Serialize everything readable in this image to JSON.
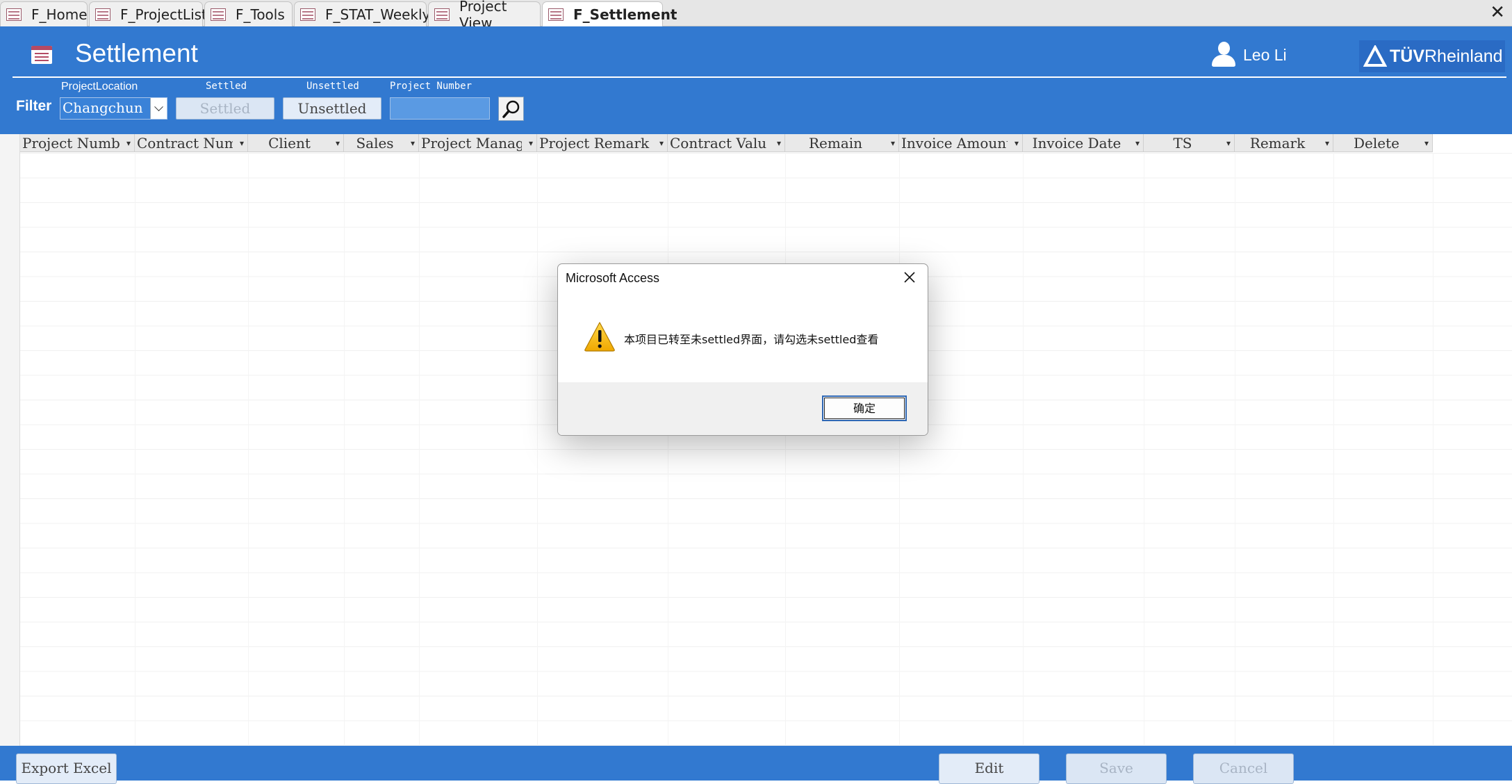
{
  "tabs": [
    {
      "label": "F_Home",
      "active": false
    },
    {
      "label": "F_ProjectList",
      "active": false
    },
    {
      "label": "F_Tools",
      "active": false
    },
    {
      "label": "F_STAT_Weekly",
      "active": false
    },
    {
      "label": "Project View",
      "active": false
    },
    {
      "label": "F_Settlement",
      "active": true
    }
  ],
  "header": {
    "title": "Settlement",
    "user_name": "Leo Li",
    "logo_text_bold": "TÜV",
    "logo_text": "Rheinland"
  },
  "filter": {
    "label": "Filter",
    "location_caption": "ProjectLocation",
    "location_value": "Changchun",
    "settled_caption": "Settled",
    "settled_label": "Settled",
    "unsettled_caption": "Unsettled",
    "unsettled_label": "Unsettled",
    "project_number_caption": "Project Number",
    "project_number_value": ""
  },
  "grid": {
    "columns": [
      "Project Number",
      "Contract Num",
      "Client",
      "Sales",
      "Project Manag",
      "Project Remark",
      "Contract Valu",
      "Remain",
      "Invoice Amount",
      "Invoice Date",
      "TS",
      "Remark",
      "Delete"
    ],
    "rows": []
  },
  "footer": {
    "export_label": "Export Excel",
    "edit_label": "Edit",
    "save_label": "Save",
    "cancel_label": "Cancel"
  },
  "dialog": {
    "title": "Microsoft Access",
    "message": "本项目已转至未settled界面，请勾选未settled查看",
    "ok_label": "确定",
    "icon": "warning-icon"
  },
  "colors": {
    "header_blue": "#3279d0",
    "dialog_ok_border": "#2e67b4"
  }
}
